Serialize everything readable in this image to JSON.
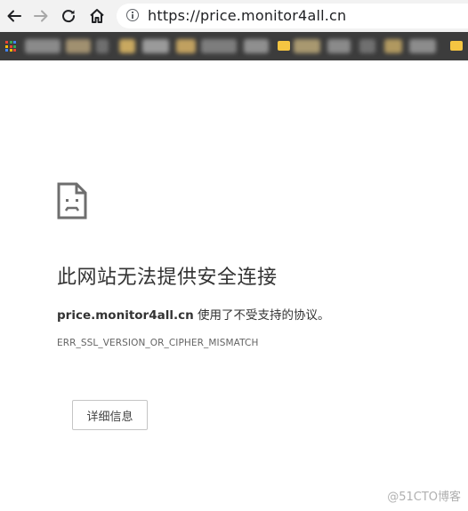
{
  "browser": {
    "address_bar": {
      "url": "https://price.monitor4all.cn"
    },
    "nav": {
      "back_icon": "back-arrow-icon",
      "forward_icon": "forward-arrow-icon",
      "reload_icon": "reload-icon",
      "home_icon": "home-icon"
    },
    "bookmarks_bar": {
      "state": "blurred"
    }
  },
  "error_page": {
    "icon": "sad-document-icon",
    "title": "此网站无法提供安全连接",
    "host": "price.monitor4all.cn",
    "message_suffix": " 使用了不受支持的协议。",
    "error_code": "ERR_SSL_VERSION_OR_CIPHER_MISMATCH",
    "details_button": "详细信息"
  },
  "watermark": "@51CTO博客",
  "colors": {
    "toolbar_bg": "#f2f2f2",
    "bookmarks_bg": "#3c3c3c",
    "text_primary": "#333333",
    "text_secondary": "#646464"
  }
}
